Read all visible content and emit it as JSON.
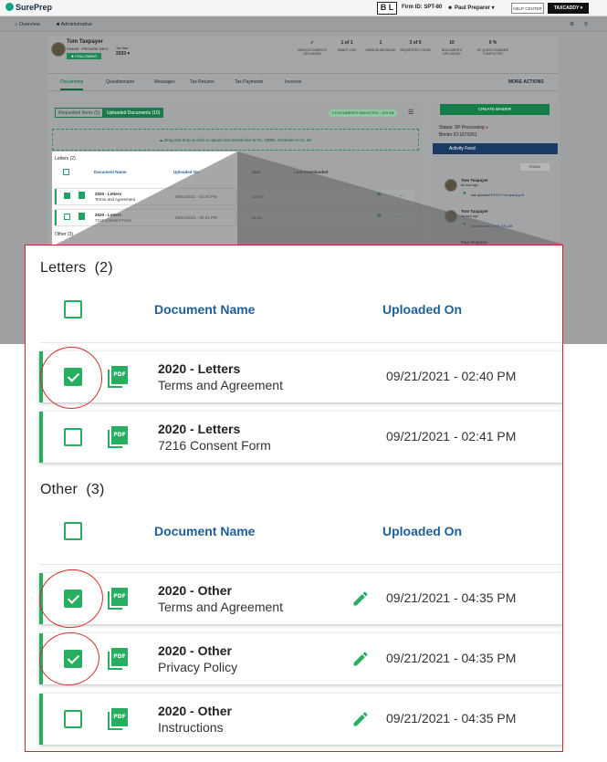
{
  "app": {
    "logo_text": "SurePrep",
    "firm_box": "B L",
    "firm_id": "Firm ID: SPT-80",
    "user_name": "Paul Preparer",
    "help_label": "HELP CENTER",
    "taxcaddy_label": "TAXCADDY"
  },
  "nav": {
    "overview": "Overview",
    "administrative": "Administrative"
  },
  "client": {
    "name": "Tom Taxpayer",
    "phase": "PHASE : PROVIDE INFO",
    "following": "FOLLOWING",
    "tax_year_label": "Tax Year",
    "tax_year": "2020"
  },
  "stats": [
    {
      "value": "✓",
      "label": "NEW DOCUMENTS UPLOADED"
    },
    {
      "value": "1 of 1",
      "label": "SMART LINK"
    },
    {
      "value": "1",
      "label": "UNREAD MESSAGE"
    },
    {
      "value": "3 of 5",
      "label": "REQUESTED ITEMS"
    },
    {
      "value": "10",
      "label": "DOCUMENTS UPLOADED"
    },
    {
      "value": "0 %",
      "label": "OF QUESTIONNAIRE COMPLETED"
    }
  ],
  "tabs": [
    "Documents",
    "Questionnaire",
    "Messages",
    "Tax Returns",
    "Tax Payments",
    "Invoices"
  ],
  "more_actions": "MORE ACTIONS",
  "doc_tabs": {
    "requested": "Requested Items (5)",
    "uploaded": "Uploaded Documents (10)"
  },
  "selected_badge": "3 DOCUMENTS SELECTED - 370 KB",
  "dropzone_text": "Drag and drop or click to upload documents like W-2s, 1099s, Schedule K-1s, etc",
  "background_columns": {
    "size": "Size",
    "last_downloaded": "Last Downloaded"
  },
  "background_sizes": [
    "120 KB",
    "63 KB"
  ],
  "sidebar": {
    "create_binder": "CREATE BINDER",
    "status": "Status: SP Processing",
    "binder_id": "Binder ID:1670261",
    "activity_feed": "Activity Feed",
    "today": "TODAY",
    "feed": [
      {
        "name": "Tom Taxpayer",
        "time": "an hour ago",
        "action": "has uploaded",
        "file": "EFGH Company.pdf"
      },
      {
        "name": "Tom Taxpayer",
        "time": "an hour ago",
        "action": "has uploaded",
        "file": "1040_ES.pdf"
      },
      {
        "name": "Paul Preparer",
        "time": "",
        "action": "",
        "file": ""
      }
    ]
  },
  "inset": {
    "letters_title": "Letters",
    "letters_count": "(2)",
    "other_title": "Other",
    "other_count": "(3)",
    "col_doc": "Document Name",
    "col_uploaded": "Uploaded On",
    "rows": [
      {
        "cat": "2020 - Letters",
        "name": "Terms and Agreement",
        "date": "09/21/2021 - 02:40 PM"
      },
      {
        "cat": "2020 - Letters",
        "name": "7216 Consent Form",
        "date": "09/21/2021 - 02:41 PM"
      }
    ]
  },
  "zoom": {
    "col_doc": "Document Name",
    "col_uploaded": "Uploaded On",
    "pdf_label": "PDF",
    "letters": {
      "title": "Letters",
      "count": "(2)",
      "rows": [
        {
          "cat": "2020 - Letters",
          "name": "Terms and Agreement",
          "date": "09/21/2021 - 02:40 PM",
          "checked": true
        },
        {
          "cat": "2020 - Letters",
          "name": "7216 Consent Form",
          "date": "09/21/2021 - 02:41 PM",
          "checked": false
        }
      ]
    },
    "other": {
      "title": "Other",
      "count": "(3)",
      "rows": [
        {
          "cat": "2020 - Other",
          "name": "Terms and Agreement",
          "date": "09/21/2021 - 04:35 PM",
          "checked": true
        },
        {
          "cat": "2020 - Other",
          "name": "Privacy Policy",
          "date": "09/21/2021 - 04:35 PM",
          "checked": true
        },
        {
          "cat": "2020 - Other",
          "name": "Instructions",
          "date": "09/21/2021 - 04:35 PM",
          "checked": false
        }
      ]
    }
  },
  "colors": {
    "green": "#27ae60",
    "blue_header": "#1f5f98",
    "annotation_red": "#d32f2f"
  }
}
